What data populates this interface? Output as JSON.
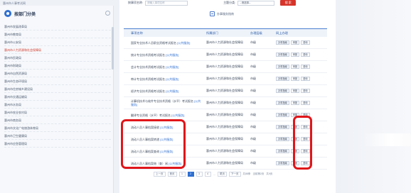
{
  "top_crumb": "惠州市人事考试网",
  "sidebar": {
    "title": "按部门分类",
    "items": [
      {
        "label": "惠州市发展改革局",
        "active": false
      },
      {
        "label": "惠州市教育局",
        "active": false
      },
      {
        "label": "惠州市公安局",
        "active": false
      },
      {
        "label": "惠州市人力资源和社会保障局",
        "active": true
      },
      {
        "label": "惠州市民政局",
        "active": false
      },
      {
        "label": "惠州市财政局",
        "active": false
      },
      {
        "label": "惠州市自然资源局",
        "active": false
      },
      {
        "label": "惠州市生态环境局",
        "active": false
      },
      {
        "label": "惠州市住房城乡建设局",
        "active": false
      },
      {
        "label": "惠州市交通运输局",
        "active": false
      },
      {
        "label": "惠州市水务局",
        "active": false
      },
      {
        "label": "惠州市农业农村局",
        "active": false
      },
      {
        "label": "惠州市商务局",
        "active": false
      },
      {
        "label": "惠州市文化广电旅游体育局",
        "active": false
      },
      {
        "label": "惠州市卫生健康局",
        "active": false
      },
      {
        "label": "惠州市应急管理局",
        "active": false
      }
    ]
  },
  "filter": {
    "name_label": "按事项名称:",
    "name_placeholder": "请输入事项名称",
    "topic_label": "主题分类:",
    "topic_value": "--请选择--",
    "search_label": "搜 索"
  },
  "guide_text": "办事服务指南",
  "table": {
    "headers": [
      "事项名称",
      "所属部门",
      "办理层级",
      "网上办理"
    ],
    "rows": [
      {
        "name": "国家专业技术人员职业资格考试报名",
        "tag": "[公共服务]",
        "dept": "惠州市人力资源和社会保障局",
        "level": "市级",
        "actions": [
          "办事指南",
          "申报",
          "咨询"
        ]
      },
      {
        "name": "统计专业技术资格考试报名",
        "tag": "[公共服务]",
        "dept": "惠州市人力资源和社会保障局",
        "level": "市级",
        "actions": [
          "办事指南",
          "申报",
          "咨询"
        ]
      },
      {
        "name": "会计专业技术资格考试报名",
        "tag": "[公共服务]",
        "dept": "惠州市人力资源和社会保障局",
        "level": "市级",
        "actions": [
          "办事指南",
          "申报",
          "咨询"
        ]
      },
      {
        "name": "审计专业技术资格考试报名",
        "tag": "[公共服务]",
        "dept": "惠州市人力资源和社会保障局",
        "level": "市级",
        "actions": [
          "办事指南",
          "申报",
          "咨询"
        ]
      },
      {
        "name": "经济专业技术资格考试报名",
        "tag": "[公共服务]",
        "dept": "惠州市人力资源和社会保障局",
        "level": "市级",
        "actions": [
          "办事指南",
          "申报",
          "咨询"
        ]
      },
      {
        "name": "计算机技术与软件专业技术资格（水平）考试报名",
        "tag": "[公共服务]",
        "dept": "惠州市人力资源和社会保障局",
        "level": "市级",
        "actions": [
          "办事指南",
          "申报",
          "咨询"
        ]
      },
      {
        "name": "翻译专业资格（水平）考试报名",
        "tag": "[公共服务]",
        "dept": "惠州市人力资源和社会保障局",
        "level": "市级",
        "actions": [
          "办事指南",
          "申报",
          "咨询"
        ]
      },
      {
        "name": "流动人员人事档案接收",
        "tag": "[公共服务]",
        "dept": "惠州市人力资源和社会保障局",
        "level": "市级",
        "actions": [
          "办事指南",
          "申报",
          "咨询"
        ]
      },
      {
        "name": "流动人员人事档案转递",
        "tag": "[公共服务]",
        "dept": "惠州市人力资源和社会保障局",
        "level": "市级",
        "actions": [
          "办事指南",
          "申报",
          "咨询"
        ]
      },
      {
        "name": "流动人员人事档案查询",
        "tag": "[公共服务]",
        "dept": "惠州市人力资源和社会保障局",
        "level": "市级",
        "actions": [
          "办事指南",
          "申报",
          "咨询"
        ]
      },
      {
        "name": "流动人员人事档案借（查）阅",
        "tag": "[公共服务]",
        "dept": "惠州市人力资源和社会保障局",
        "level": "市级",
        "actions": [
          "办事指南",
          "申报",
          "咨询"
        ]
      }
    ]
  },
  "pager": {
    "prev": "上一页",
    "first": "首页",
    "pages": [
      "1",
      "2",
      "3",
      "4"
    ],
    "current": "2",
    "ellipsis": "…",
    "last": "尾页",
    "next": "下一页",
    "info1": "共88条",
    "info2": "当前第2页",
    "info3": "共9页"
  },
  "annotation_color": "#e0161a"
}
